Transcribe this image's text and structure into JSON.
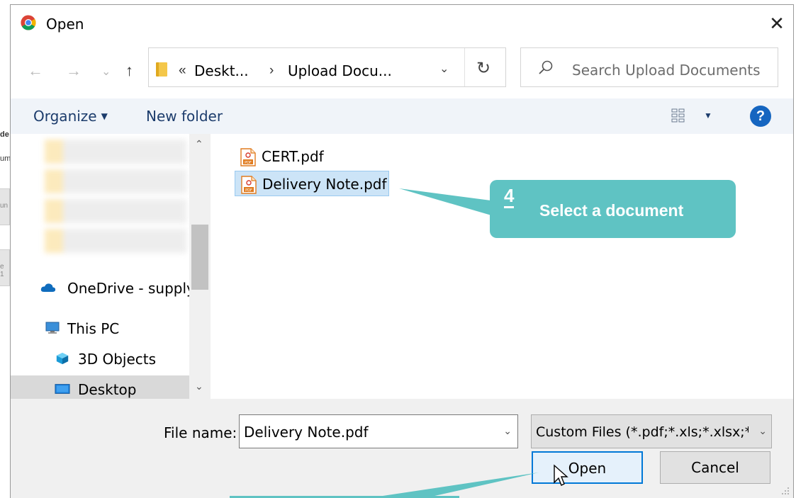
{
  "window": {
    "title": "Open",
    "close_glyph": "✕"
  },
  "background": {
    "fragments": [
      "de",
      "um",
      "un",
      "e 1"
    ]
  },
  "navigation": {
    "back_glyph": "←",
    "forward_glyph": "→",
    "recent_glyph": "⌄",
    "up_glyph": "↑",
    "address": {
      "overflow_glyph": "«",
      "crumbs": [
        "Deskt...",
        "Upload Docu..."
      ],
      "separator": "›",
      "dropdown_glyph": "⌄",
      "refresh_glyph": "↻"
    },
    "search": {
      "placeholder": "Search Upload Documents"
    }
  },
  "toolbar": {
    "organize_label": "Organize",
    "organize_caret": "▼",
    "new_folder_label": "New folder",
    "view_caret": "▼",
    "help_label": "?"
  },
  "nav_pane": {
    "items": [
      {
        "label": "OneDrive - supply",
        "icon": "onedrive-icon"
      },
      {
        "label": "This PC",
        "icon": "computer-icon"
      },
      {
        "label": "3D Objects",
        "icon": "cube-icon"
      },
      {
        "label": "Desktop",
        "icon": "desktop-icon"
      }
    ],
    "scroll_up_glyph": "⌃",
    "scroll_down_glyph": "⌄"
  },
  "files": [
    {
      "name": "CERT.pdf",
      "selected": false
    },
    {
      "name": "Delivery Note.pdf",
      "selected": true
    }
  ],
  "bottom": {
    "file_name_label": "File name:",
    "file_name_value": "Delivery Note.pdf",
    "file_type_value": "Custom Files (*.pdf;*.xls;*.xlsx;*.jpg",
    "dropdown_glyph": "⌄",
    "open_label": "Open",
    "cancel_label": "Cancel"
  },
  "callout": {
    "step": "4",
    "text": "Select a document"
  },
  "colors": {
    "callout": "#5fc3c3",
    "accent": "#0078d7",
    "selection": "#cce4f7",
    "toolbar": "#f0f4f9"
  }
}
